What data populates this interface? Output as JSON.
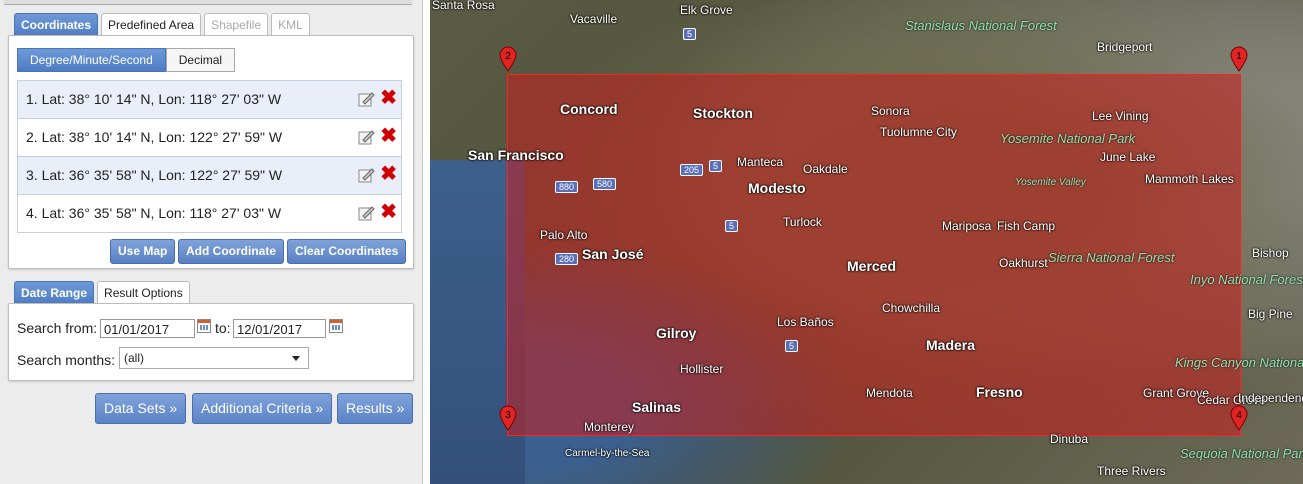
{
  "coord_tabs": [
    "Coordinates",
    "Predefined Area",
    "Shapefile",
    "KML"
  ],
  "format_toggle": {
    "dms": "Degree/Minute/Second",
    "decimal": "Decimal"
  },
  "coordinates": [
    "1.  Lat: 38° 10' 14\" N, Lon: 118° 27' 03\" W",
    "2.  Lat: 38° 10' 14\" N, Lon: 122° 27' 59\" W",
    "3.  Lat: 36° 35' 58\" N, Lon: 122° 27' 59\" W",
    "4.  Lat: 36° 35' 58\" N, Lon: 118° 27' 03\" W"
  ],
  "coord_buttons": {
    "use_map": "Use Map",
    "add": "Add Coordinate",
    "clear": "Clear Coordinates"
  },
  "date_tabs": [
    "Date Range",
    "Result Options"
  ],
  "date_range": {
    "from_label": "Search from:",
    "from_value": "01/01/2017",
    "to_label": "to:",
    "to_value": "12/01/2017",
    "months_label": "Search months:",
    "months_value": "(all)"
  },
  "nav_buttons": {
    "data_sets": "Data Sets »",
    "additional": "Additional Criteria »",
    "results": "Results »"
  },
  "map": {
    "cities": [
      "Santa Rosa",
      "Vacaville",
      "Elk Grove",
      "Bridgeport",
      "Concord",
      "Stockton",
      "Sonora",
      "Lee Vining",
      "San Francisco",
      "Tuolumne City",
      "Manteca",
      "Oakdale",
      "June Lake",
      "Modesto",
      "Mammoth Lakes",
      "Turlock",
      "Palo Alto",
      "San José",
      "Mariposa",
      "Fish Camp",
      "Bishop",
      "Merced",
      "Oakhurst",
      "Los Baños",
      "Chowchilla",
      "Big Pine",
      "Gilroy",
      "Madera",
      "Hollister",
      "Fresno",
      "Mendota",
      "Grant Grove",
      "Cedar Grove",
      "Salinas",
      "Independence",
      "Monterey",
      "Carmel-by-the-Sea",
      "Dinuba",
      "Three Rivers"
    ],
    "parks": [
      "Stanislaus National Forest",
      "Yosemite National Park",
      "Yosemite Valley",
      "Sierra National Forest",
      "Inyo National Forest",
      "Kings Canyon National Park",
      "Sequoia National Park"
    ],
    "highways": [
      "5",
      "205",
      "5",
      "880",
      "580",
      "5",
      "280",
      "5"
    ],
    "markers": [
      "1",
      "2",
      "3",
      "4"
    ]
  }
}
